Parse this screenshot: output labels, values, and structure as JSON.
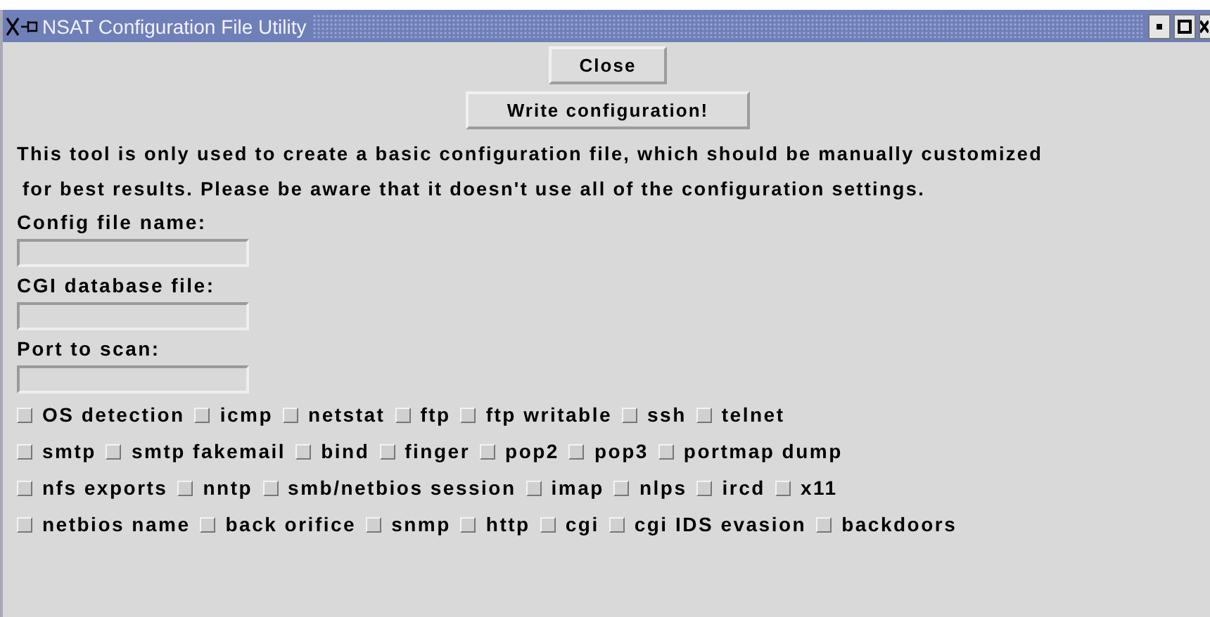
{
  "window": {
    "title": "NSAT Configuration File Utility"
  },
  "buttons": [
    "Close",
    "Write configuration!"
  ],
  "description": [
    "This tool is only used to create a basic configuration file, which should be manually customized",
    "for best results. Please be aware that it doesn't use all of the configuration settings."
  ],
  "fields": [
    {
      "label": "Config file name:"
    },
    {
      "label": "CGI database file:"
    },
    {
      "label": "Port to scan:"
    }
  ],
  "option_rows": [
    [
      {
        "label": "OS detection",
        "checked": false
      },
      {
        "label": "icmp",
        "checked": false
      },
      {
        "label": "netstat",
        "checked": false
      },
      {
        "label": "ftp",
        "checked": false
      },
      {
        "label": "ftp writable",
        "checked": false
      },
      {
        "label": "ssh",
        "checked": false
      },
      {
        "label": "telnet",
        "checked": false
      }
    ],
    [
      {
        "label": "smtp",
        "checked": false
      },
      {
        "label": "smtp fakemail",
        "checked": false
      },
      {
        "label": "bind",
        "checked": false
      },
      {
        "label": "finger",
        "checked": false
      },
      {
        "label": "pop2",
        "checked": false
      },
      {
        "label": "pop3",
        "checked": false
      },
      {
        "label": "portmap dump",
        "checked": false
      }
    ],
    [
      {
        "label": "nfs exports",
        "checked": false
      },
      {
        "label": "nntp",
        "checked": false
      },
      {
        "label": "smb/netbios session",
        "checked": false
      },
      {
        "label": "imap",
        "checked": false
      },
      {
        "label": "nlps",
        "checked": false
      },
      {
        "label": "ircd",
        "checked": false
      },
      {
        "label": "x11",
        "checked": false
      }
    ],
    [
      {
        "label": "netbios name",
        "checked": false
      },
      {
        "label": "back orifice",
        "checked": false
      },
      {
        "label": "snmp",
        "checked": false
      },
      {
        "label": "http",
        "checked": false
      },
      {
        "label": "cgi",
        "checked": false
      },
      {
        "label": "cgi IDS evasion",
        "checked": false
      },
      {
        "label": "backdoors",
        "checked": false
      }
    ]
  ]
}
